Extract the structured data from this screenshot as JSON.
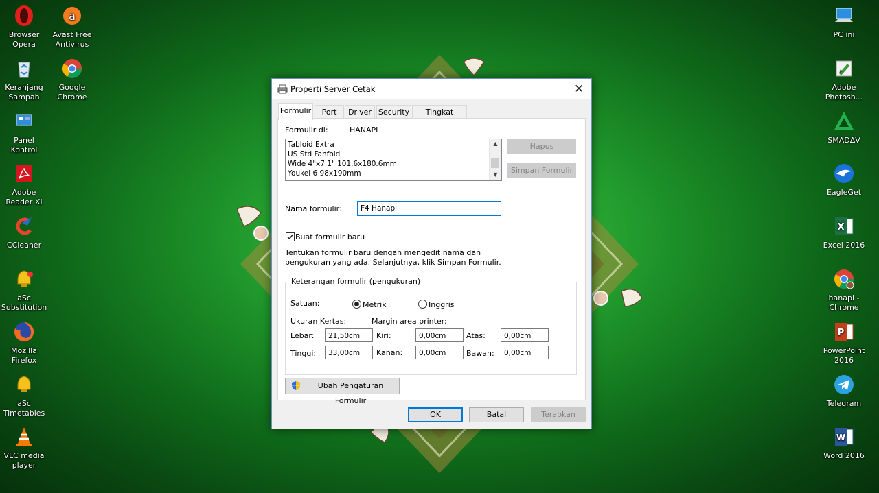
{
  "desktop": {
    "left_icons": [
      {
        "line1": "Browser",
        "line2": "Opera"
      },
      {
        "line1": "Avast Free",
        "line2": "Antivirus"
      },
      {
        "line1": "Keranjang",
        "line2": "Sampah"
      },
      {
        "line1": "Google",
        "line2": "Chrome"
      },
      {
        "line1": "Panel Kontrol",
        "line2": ""
      },
      {
        "line1": "Adobe",
        "line2": "Reader XI"
      },
      {
        "line1": "CCleaner",
        "line2": ""
      },
      {
        "line1": "aSc",
        "line2": "Substitution"
      },
      {
        "line1": "Mozilla",
        "line2": "Firefox"
      },
      {
        "line1": "aSc",
        "line2": "Timetables"
      },
      {
        "line1": "VLC media",
        "line2": "player"
      }
    ],
    "right_icons": [
      {
        "line1": "PC ini",
        "line2": ""
      },
      {
        "line1": "Adobe",
        "line2": "Photosh..."
      },
      {
        "line1": "SMADΔV",
        "line2": ""
      },
      {
        "line1": "EagleGet",
        "line2": ""
      },
      {
        "line1": "Excel 2016",
        "line2": ""
      },
      {
        "line1": "hanapi -",
        "line2": "Chrome"
      },
      {
        "line1": "PowerPoint",
        "line2": "2016"
      },
      {
        "line1": "Telegram",
        "line2": ""
      },
      {
        "line1": "Word 2016",
        "line2": ""
      }
    ]
  },
  "dialog": {
    "title": "Properti Server Cetak",
    "close_glyph": "✕",
    "tabs": [
      {
        "label": "Formulir"
      },
      {
        "label": "Port"
      },
      {
        "label": "Driver"
      },
      {
        "label": "Security"
      },
      {
        "label": "Tingkat Lanjut"
      }
    ],
    "forms_on_label": "Formulir di:",
    "forms_on_value": "HANAPI",
    "form_list": [
      "Tabloid Extra",
      "US Std Fanfold",
      "Wide 4\"x7.1\" 101.6x180.6mm",
      "Youkei 6 98x190mm"
    ],
    "delete_button": "Hapus",
    "save_form_button": "Simpan Formulir",
    "form_name_label": "Nama formulir:",
    "form_name_value": "F4 Hanapi",
    "create_new_form_label": "Buat formulir baru",
    "create_new_form_checked": true,
    "instructions_line1": "Tentukan formulir baru dengan mengedit nama dan",
    "instructions_line2": "pengukuran yang ada. Selanjutnya, klik Simpan Formulir.",
    "group_title": "Keterangan formulir (pengukuran)",
    "units_label": "Satuan:",
    "unit_metric": "Metrik",
    "unit_english": "Inggris",
    "selected_unit": "Metrik",
    "paper_size_label": "Ukuran Kertas:",
    "margin_label": "Margin area printer:",
    "width_label": "Lebar:",
    "width_value": "21,50cm",
    "height_label": "Tinggi:",
    "height_value": "33,00cm",
    "left_label": "Kiri:",
    "left_value": "0,00cm",
    "right_label": "Kanan:",
    "right_value": "0,00cm",
    "top_label": "Atas:",
    "top_value": "0,00cm",
    "bottom_label": "Bawah:",
    "bottom_value": "0,00cm",
    "change_settings_button": "Ubah Pengaturan Formulir",
    "ok_button": "OK",
    "cancel_button": "Batal",
    "apply_button": "Terapkan"
  },
  "colors": {
    "accent": "#0078d7",
    "disabled_button": "#cccccc",
    "disabled_text": "#838383"
  }
}
